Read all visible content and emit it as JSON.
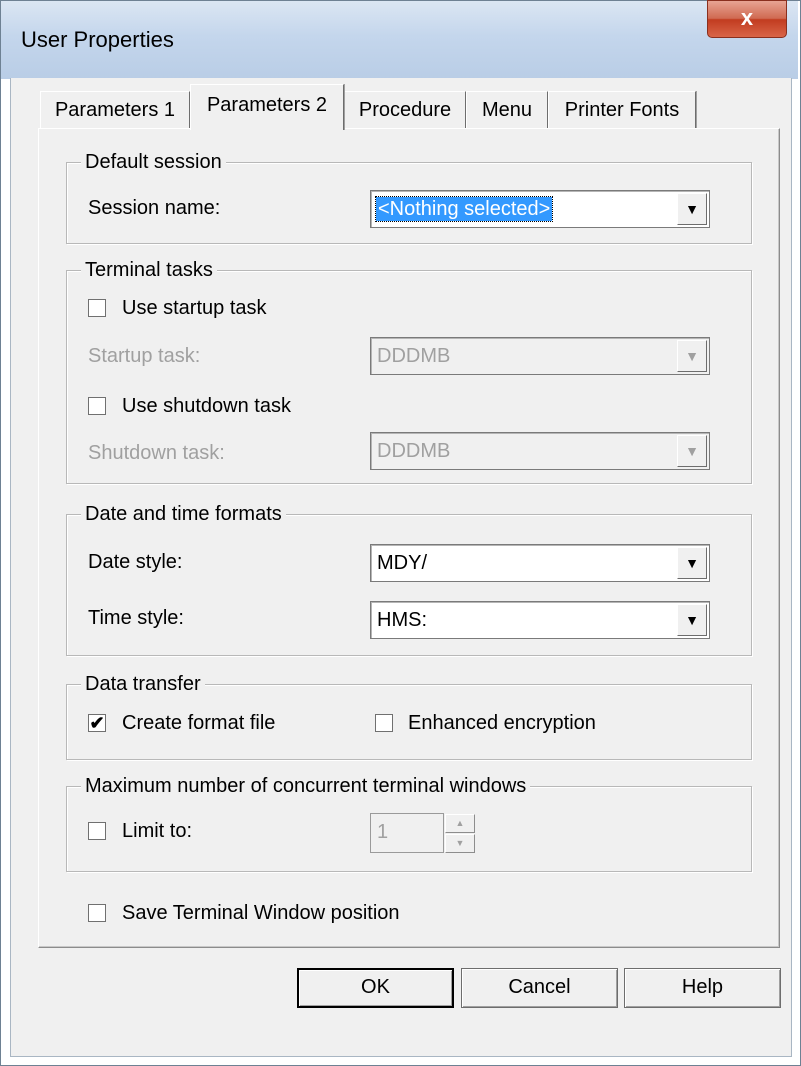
{
  "window": {
    "title": "User Properties",
    "close_glyph": "x"
  },
  "tabs": [
    {
      "label": "Parameters 1",
      "active": false
    },
    {
      "label": "Parameters 2",
      "active": true
    },
    {
      "label": "Procedure",
      "active": false
    },
    {
      "label": "Menu",
      "active": false
    },
    {
      "label": "Printer Fonts",
      "active": false
    }
  ],
  "default_session": {
    "legend": "Default session",
    "session_name_label": "Session name:",
    "session_name_value": "<Nothing selected>"
  },
  "terminal_tasks": {
    "legend": "Terminal tasks",
    "use_startup_label": "Use startup task",
    "use_startup_checked": false,
    "startup_task_label": "Startup task:",
    "startup_task_value": "DDDMB",
    "use_shutdown_label": "Use shutdown task",
    "use_shutdown_checked": false,
    "shutdown_task_label": "Shutdown task:",
    "shutdown_task_value": "DDDMB"
  },
  "date_time": {
    "legend": "Date and time formats",
    "date_style_label": "Date style:",
    "date_style_value": "MDY/",
    "time_style_label": "Time style:",
    "time_style_value": "HMS:"
  },
  "data_transfer": {
    "legend": "Data transfer",
    "create_format_label": "Create format file",
    "create_format_checked": true,
    "enhanced_encryption_label": "Enhanced encryption",
    "enhanced_encryption_checked": false
  },
  "max_windows": {
    "legend": "Maximum number of concurrent terminal windows",
    "limit_to_label": "Limit to:",
    "limit_to_checked": false,
    "limit_value": "1"
  },
  "save_position": {
    "label": "Save Terminal Window position",
    "checked": false
  },
  "buttons": {
    "ok": "OK",
    "cancel": "Cancel",
    "help": "Help"
  },
  "icons": {
    "dropdown": "▼",
    "check": "✔",
    "spin_up": "▲",
    "spin_down": "▼"
  }
}
